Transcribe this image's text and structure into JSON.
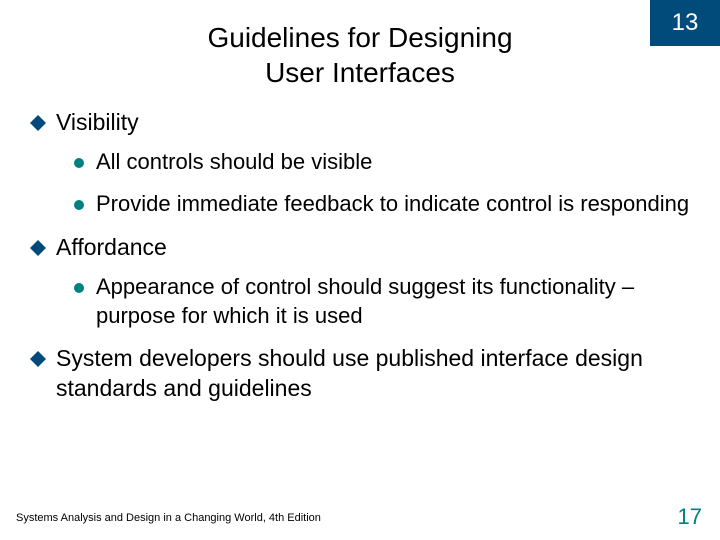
{
  "chapter_number": "13",
  "title_line1": "Guidelines for Designing",
  "title_line2": "User Interfaces",
  "items": {
    "a": {
      "heading": "Visibility",
      "subs": {
        "a": "All controls should be visible",
        "b": "Provide immediate feedback to indicate control is responding"
      }
    },
    "b": {
      "heading": "Affordance",
      "subs": {
        "a": "Appearance of control should suggest its functionality – purpose for which it is used"
      }
    },
    "c": {
      "heading": "System developers should use published interface design standards and guidelines"
    }
  },
  "footer_left": "Systems Analysis and Design in a Changing World, 4th Edition",
  "page_number": "17"
}
